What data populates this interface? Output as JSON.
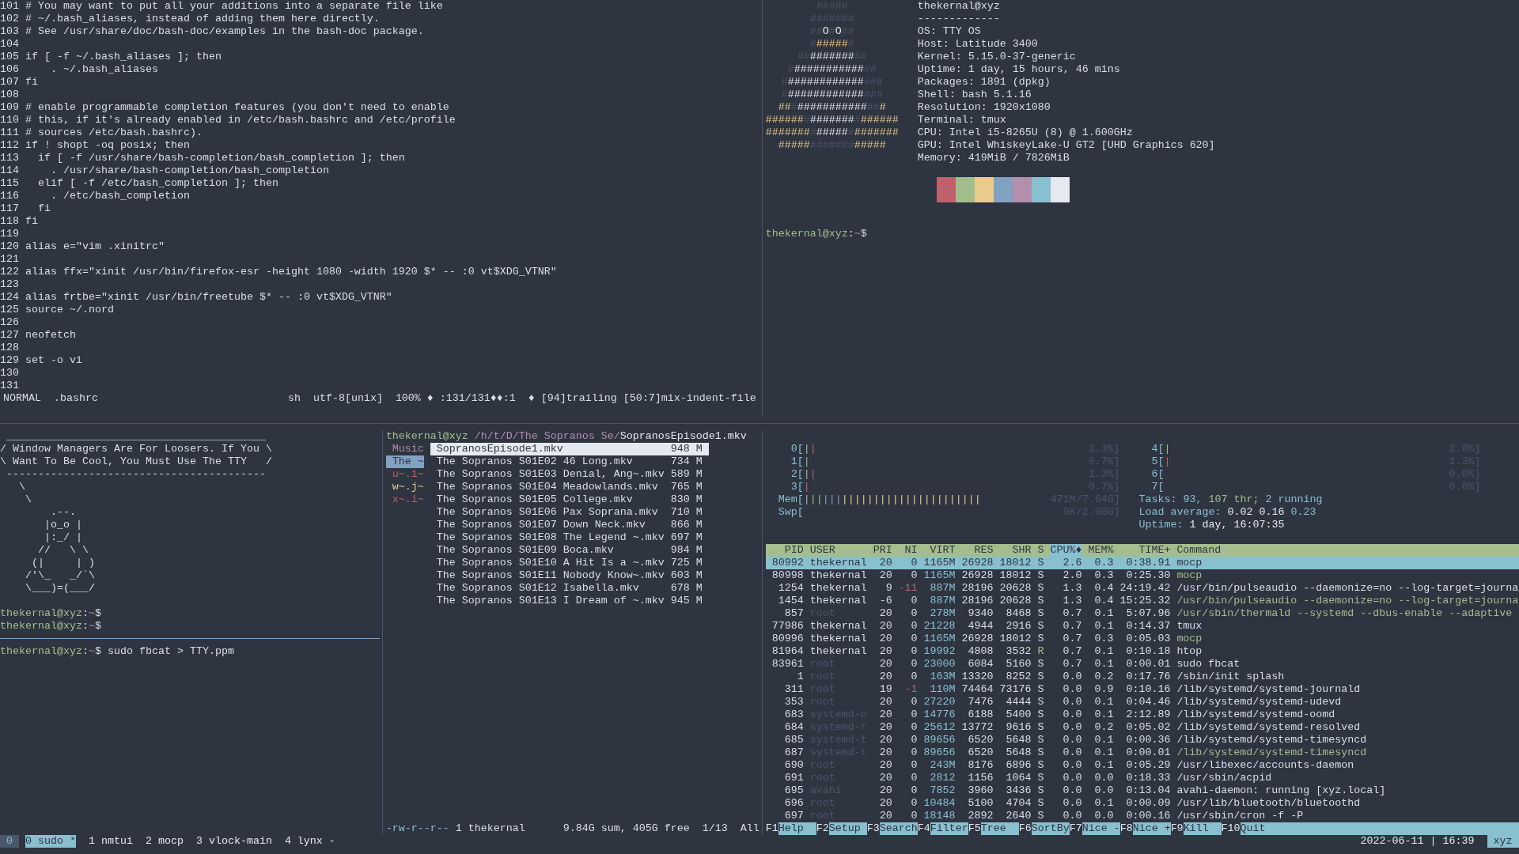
{
  "vim": {
    "lines": [
      {
        "number": "101",
        "text": "# You may want to put all your additions into a separate file like"
      },
      {
        "number": "102",
        "text": "# ~/.bash_aliases, instead of adding them here directly."
      },
      {
        "number": "103",
        "text": "# See /usr/share/doc/bash-doc/examples in the bash-doc package."
      },
      {
        "number": "104"
      },
      {
        "number": "105",
        "text": "if [ -f ~/.bash_aliases ]; then"
      },
      {
        "number": "106",
        "text": "    . ~/.bash_aliases"
      },
      {
        "number": "107",
        "text": "fi"
      },
      {
        "number": "108"
      },
      {
        "number": "109",
        "text": "# enable programmable completion features (you don't need to enable"
      },
      {
        "number": "110",
        "text": "# this, if it's already enabled in /etc/bash.bashrc and /etc/profile"
      },
      {
        "number": "111",
        "text": "# sources /etc/bash.bashrc)."
      },
      {
        "number": "112",
        "text": "if ! shopt -oq posix; then"
      },
      {
        "number": "113",
        "text": "  if [ -f /usr/share/bash-completion/bash_completion ]; then"
      },
      {
        "number": "114",
        "text": "    . /usr/share/bash-completion/bash_completion"
      },
      {
        "number": "115",
        "text": "  elif [ -f /etc/bash_completion ]; then"
      },
      {
        "number": "116",
        "text": "    . /etc/bash_completion"
      },
      {
        "number": "117",
        "text": "  fi"
      },
      {
        "number": "118",
        "text": "fi"
      },
      {
        "number": "119"
      },
      {
        "number": "120",
        "text": "alias e=\"vim .xinitrc\""
      },
      {
        "number": "121"
      },
      {
        "number": "122",
        "text": "alias ffx=\"xinit /usr/bin/firefox-esr -height 1080 -width 1920 $* -- :0 vt$XDG_VTNR\""
      },
      {
        "number": "123"
      },
      {
        "number": "124",
        "text": "alias frtbe=\"xinit /usr/bin/freetube $* -- :0 vt$XDG_VTNR\""
      },
      {
        "number": "125",
        "text": "source ~/.nord"
      },
      {
        "number": "126"
      },
      {
        "number": "127",
        "text": "neofetch"
      },
      {
        "number": "128"
      },
      {
        "number": "129",
        "text": "set -o vi"
      },
      {
        "number": "130"
      },
      {
        "number": "131"
      }
    ],
    "status": {
      "mode": "NORMAL",
      "file": ".bashrc",
      "filetype": "sh",
      "encoding": "utf-8[unix]",
      "position": "100% ♦ :131/131♦♦:1",
      "warnings": "♦ [94]trailing [50:7]mix-indent-file"
    }
  },
  "neofetch": {
    "logo": [
      [
        {
          "text": "#####",
          "kind": "dim"
        }
      ],
      [
        {
          "text": "#######",
          "kind": "dim"
        }
      ],
      [
        {
          "text": "##",
          "kind": "dim"
        },
        {
          "text": "O",
          "kind": "white"
        },
        {
          "text": "#",
          "kind": "dim"
        },
        {
          "text": "O",
          "kind": "white"
        },
        {
          "text": "##",
          "kind": "dim"
        }
      ],
      [
        {
          "text": "#",
          "kind": "dim"
        },
        {
          "text": "#####",
          "kind": "yellow"
        },
        {
          "text": "#",
          "kind": "dim"
        }
      ],
      [
        {
          "text": "##",
          "kind": "dim"
        },
        {
          "text": "#######",
          "kind": "white"
        },
        {
          "text": "##",
          "kind": "dim"
        }
      ],
      [
        {
          "text": "#",
          "kind": "dim"
        },
        {
          "text": "###########",
          "kind": "white"
        },
        {
          "text": "##",
          "kind": "dim"
        }
      ],
      [
        {
          "text": "#",
          "kind": "dim"
        },
        {
          "text": "############",
          "kind": "white"
        },
        {
          "text": "###",
          "kind": "dim"
        }
      ],
      [
        {
          "text": "#",
          "kind": "dim"
        },
        {
          "text": "############",
          "kind": "white"
        },
        {
          "text": "###",
          "kind": "dim"
        }
      ],
      [
        {
          "text": "##",
          "kind": "yellow"
        },
        {
          "text": "#",
          "kind": "dim"
        },
        {
          "text": "###########",
          "kind": "white"
        },
        {
          "text": "##",
          "kind": "dim"
        },
        {
          "text": "#",
          "kind": "yellow"
        }
      ],
      [
        {
          "text": "######",
          "kind": "yellow"
        },
        {
          "text": "#",
          "kind": "dim"
        },
        {
          "text": "#######",
          "kind": "white"
        },
        {
          "text": "#",
          "kind": "dim"
        },
        {
          "text": "######",
          "kind": "yellow"
        }
      ],
      [
        {
          "text": "#######",
          "kind": "yellow"
        },
        {
          "text": "#",
          "kind": "dim"
        },
        {
          "text": "#####",
          "kind": "white"
        },
        {
          "text": "#",
          "kind": "dim"
        },
        {
          "text": "#######",
          "kind": "yellow"
        }
      ],
      [
        {
          "text": "#####",
          "kind": "yellow"
        },
        {
          "text": "#######",
          "kind": "dim"
        },
        {
          "text": "#####",
          "kind": "yellow"
        }
      ]
    ],
    "info": [
      "thekernal@xyz",
      "-------------",
      "OS: TTY OS",
      "Host: Latitude 3400",
      "Kernel: 5.15.0-37-generic",
      "Uptime: 1 day, 15 hours, 46 mins",
      "Packages: 1891 (dpkg)",
      "Shell: bash 5.1.16",
      "Resolution: 1920x1080",
      "Terminal: tmux",
      "CPU: Intel i5-8265U (8) @ 1.600GHz",
      "GPU: Intel WhiskeyLake-U GT2 [UHD Graphics 620]",
      "Memory: 419MiB / 7826MiB"
    ],
    "swatches": [
      {
        "color": "#bf616a"
      },
      {
        "color": "#a3be8c"
      },
      {
        "color": "#ebcb8b"
      },
      {
        "color": "#81a1c1"
      },
      {
        "color": "#b48ead"
      },
      {
        "color": "#88c0d0"
      },
      {
        "color": "#e5e9f0"
      }
    ],
    "prompt": [
      {
        "text": "thekernal@xyz",
        "kind": "user"
      },
      {
        "text": ":",
        "kind": "plain"
      },
      {
        "text": "~",
        "kind": "path"
      },
      {
        "text": "$",
        "kind": "plain"
      }
    ]
  },
  "cowsay": [
    " _________________________________________",
    "/ Window Managers Are For Loosers. If You \\",
    "\\ Want To Be Cool, You Must Use The TTY   /",
    " -----------------------------------------",
    "   \\",
    "    \\",
    "        .--.",
    "       |o_o |",
    "       |:_/ |",
    "      //   \\ \\",
    "     (|     | )",
    "    /'\\_   _/`\\",
    "    \\___)=(___/"
  ],
  "shell_prompts": [
    [
      {
        "text": "thekernal@xyz",
        "kind": "user"
      },
      {
        "text": ":",
        "kind": "plain"
      },
      {
        "text": "~",
        "kind": "path"
      },
      {
        "text": "$",
        "kind": "plain"
      }
    ],
    [
      {
        "text": "thekernal@xyz",
        "kind": "user"
      },
      {
        "text": ":",
        "kind": "plain"
      },
      {
        "text": "~",
        "kind": "path"
      },
      {
        "text": "$",
        "kind": "plain"
      }
    ]
  ],
  "lower_shell": [
    {
      "text": "thekernal@xyz",
      "kind": "user"
    },
    {
      "text": ":",
      "kind": "plain"
    },
    {
      "text": "~",
      "kind": "path"
    },
    {
      "text": "$ sudo fbcat > TTY.ppm",
      "kind": "plain"
    }
  ],
  "ranger": {
    "path": [
      {
        "text": "thekernal@xyz",
        "kind": "user"
      },
      {
        "text": " /h/t/D/The Sopranos Se/",
        "kind": "path"
      },
      {
        "text": "SopranosEpisode1.mkv",
        "kind": "white"
      }
    ],
    "parent": [
      {
        "label": "Music",
        "selected": false,
        "color": "#b48ead"
      },
      {
        "label": "The ~",
        "selected": true,
        "color": "#81a1c1"
      },
      {
        "label": "u~.i~",
        "selected": false,
        "color": "#bf616a"
      },
      {
        "label": "w~.j~",
        "selected": false,
        "color": "#ebcb8b"
      },
      {
        "label": "x~.i~",
        "selected": false,
        "color": "#bf616a"
      }
    ],
    "files": [
      {
        "name": "SopranosEpisode1.mkv",
        "size": "948 M",
        "selected": true
      },
      {
        "name": "The Sopranos S01E02 46 Long.mkv",
        "size": "734 M",
        "selected": false
      },
      {
        "name": "The Sopranos S01E03 Denial, Ang~.mkv",
        "size": "589 M",
        "selected": false
      },
      {
        "name": "The Sopranos S01E04 Meadowlands.mkv",
        "size": "765 M",
        "selected": false
      },
      {
        "name": "The Sopranos S01E05 College.mkv",
        "size": "830 M",
        "selected": false
      },
      {
        "name": "The Sopranos S01E06 Pax Soprana.mkv",
        "size": "710 M",
        "selected": false
      },
      {
        "name": "The Sopranos S01E07 Down Neck.mkv",
        "size": "866 M",
        "selected": false
      },
      {
        "name": "The Sopranos S01E08 The Legend ~.mkv",
        "size": "697 M",
        "selected": false
      },
      {
        "name": "The Sopranos S01E09 Boca.mkv",
        "size": "984 M",
        "selected": false
      },
      {
        "name": "The Sopranos S01E10 A Hit Is a ~.mkv",
        "size": "725 M",
        "selected": false
      },
      {
        "name": "The Sopranos S01E11 Nobody Know~.mkv",
        "size": "603 M",
        "selected": false
      },
      {
        "name": "The Sopranos S01E12 Isabella.mkv",
        "size": "678 M",
        "selected": false
      },
      {
        "name": "The Sopranos S01E13 I Dream of ~.mkv",
        "size": "945 M",
        "selected": false
      }
    ],
    "footer": {
      "info": [
        {
          "text": "-rw-r--r--",
          "kind": "cyan"
        },
        {
          "text": " 1 thekernal",
          "kind": "plain"
        }
      ],
      "usage": "9.84G sum, 405G free",
      "position": "1/13",
      "scroll": "All"
    }
  },
  "htop": {
    "meters_left": [
      {
        "label": "0[",
        "bar": [
          {
            "text": "|",
            "kind": "green"
          },
          {
            "text": "|",
            "kind": "red"
          }
        ],
        "reading": "1.3%]"
      },
      {
        "label": "1[",
        "bar": [
          {
            "text": "|",
            "kind": "green"
          }
        ],
        "reading": "0.7%]"
      },
      {
        "label": "2[",
        "bar": [
          {
            "text": "|",
            "kind": "green"
          },
          {
            "text": "|",
            "kind": "red"
          }
        ],
        "reading": "1.3%]"
      },
      {
        "label": "3[",
        "bar": [
          {
            "text": "|",
            "kind": "red"
          }
        ],
        "reading": "0.7%]"
      },
      {
        "label": "Mem[",
        "bar": [
          {
            "text": "|||",
            "kind": "green"
          },
          {
            "text": "|||",
            "kind": "blue"
          },
          {
            "text": "||||||||||||||||||||||",
            "kind": "yellow"
          }
        ],
        "reading": "471M/7.64G]"
      },
      {
        "label": "Swp[",
        "reading": "0K/2.00G]"
      }
    ],
    "meters_right": [
      {
        "label": "4[",
        "bar": [
          {
            "text": "|",
            "kind": "green"
          }
        ],
        "reading": "2.0%]"
      },
      {
        "label": "5[",
        "bar": [
          {
            "text": "|",
            "kind": "red"
          }
        ],
        "reading": "1.3%]"
      },
      {
        "label": "6[",
        "reading": "0.0%]"
      },
      {
        "label": "7[",
        "reading": "0.0%]"
      }
    ],
    "summary": [
      [
        {
          "text": "Tasks: 93, ",
          "kind": "cyan"
        },
        {
          "text": "107 thr; ",
          "kind": "green"
        },
        {
          "text": "2 running",
          "kind": "cyan"
        }
      ],
      [
        {
          "text": "Load average: ",
          "kind": "cyan"
        },
        {
          "text": "0.02 0.16 ",
          "kind": "white"
        },
        {
          "text": "0.23",
          "kind": "cyan"
        }
      ],
      [
        {
          "text": "Uptime: ",
          "kind": "cyan"
        },
        {
          "text": "1 day, 16:07:35",
          "kind": "white"
        }
      ]
    ],
    "columns": [
      {
        "label": "PID",
        "sorted": false
      },
      {
        "label": "USER",
        "sorted": false
      },
      {
        "label": "PRI",
        "sorted": false
      },
      {
        "label": "NI",
        "sorted": false
      },
      {
        "label": "VIRT",
        "sorted": false
      },
      {
        "label": "RES",
        "sorted": false
      },
      {
        "label": "SHR",
        "sorted": false
      },
      {
        "label": "S",
        "sorted": false
      },
      {
        "label": "CPU%♦",
        "sorted": true
      },
      {
        "label": "MEM%",
        "sorted": false
      },
      {
        "label": "TIME+",
        "sorted": false
      },
      {
        "label": "Command",
        "sorted": false
      }
    ],
    "rows": [
      {
        "cells": [
          "80992",
          "thekernal",
          "20",
          "0",
          "1165M",
          "26928",
          "18012",
          "S",
          "2.6",
          "0.3",
          "0:38.91",
          "mocp"
        ],
        "selected": true,
        "dimmed": false,
        "elevated": false,
        "running": false,
        "thread": false
      },
      {
        "cells": [
          "80998",
          "thekernal",
          "20",
          "0",
          "1165M",
          "26928",
          "18012",
          "S",
          "2.0",
          "0.3",
          "0:25.30",
          "mocp"
        ],
        "selected": false,
        "dimmed": false,
        "elevated": false,
        "running": false,
        "thread": true
      },
      {
        "cells": [
          "1254",
          "thekernal",
          "9",
          "-11",
          "887M",
          "28196",
          "20628",
          "S",
          "1.3",
          "0.4",
          "24:19.42",
          "/usr/bin/pulseaudio --daemonize=no --log-target=journa"
        ],
        "selected": false,
        "dimmed": false,
        "elevated": true,
        "running": false,
        "thread": false
      },
      {
        "cells": [
          "1454",
          "thekernal",
          "-6",
          "0",
          "887M",
          "28196",
          "20628",
          "S",
          "1.3",
          "0.4",
          "15:25.32",
          "/usr/bin/pulseaudio --daemonize=no --log-target=journa"
        ],
        "selected": false,
        "dimmed": false,
        "elevated": false,
        "running": false,
        "thread": true
      },
      {
        "cells": [
          "857",
          "root",
          "20",
          "0",
          "278M",
          "9340",
          "8468",
          "S",
          "0.7",
          "0.1",
          "5:07.96",
          "/usr/sbin/thermald --systemd --dbus-enable --adaptive"
        ],
        "selected": false,
        "dimmed": true,
        "elevated": false,
        "running": false,
        "thread": true
      },
      {
        "cells": [
          "77986",
          "thekernal",
          "20",
          "0",
          "21228",
          "4944",
          "2916",
          "S",
          "0.7",
          "0.1",
          "0:14.37",
          "tmux"
        ],
        "selected": false,
        "dimmed": false,
        "elevated": false,
        "running": false,
        "thread": false
      },
      {
        "cells": [
          "80996",
          "thekernal",
          "20",
          "0",
          "1165M",
          "26928",
          "18012",
          "S",
          "0.7",
          "0.3",
          "0:05.03",
          "mocp"
        ],
        "selected": false,
        "dimmed": false,
        "elevated": false,
        "running": false,
        "thread": true
      },
      {
        "cells": [
          "81964",
          "thekernal",
          "20",
          "0",
          "19992",
          "4808",
          "3532",
          "R",
          "0.7",
          "0.1",
          "0:10.18",
          "htop"
        ],
        "selected": false,
        "dimmed": false,
        "elevated": false,
        "running": true,
        "thread": false
      },
      {
        "cells": [
          "83961",
          "root",
          "20",
          "0",
          "23000",
          "6084",
          "5160",
          "S",
          "0.7",
          "0.1",
          "0:00.01",
          "sudo fbcat"
        ],
        "selected": false,
        "dimmed": true,
        "elevated": false,
        "running": false,
        "thread": false
      },
      {
        "cells": [
          "1",
          "root",
          "20",
          "0",
          "163M",
          "13320",
          "8252",
          "S",
          "0.0",
          "0.2",
          "0:17.76",
          "/sbin/init splash"
        ],
        "selected": false,
        "dimmed": true,
        "elevated": false,
        "running": false,
        "thread": false
      },
      {
        "cells": [
          "311",
          "root",
          "19",
          "-1",
          "110M",
          "74464",
          "73176",
          "S",
          "0.0",
          "0.9",
          "0:10.16",
          "/lib/systemd/systemd-journald"
        ],
        "selected": false,
        "dimmed": true,
        "elevated": true,
        "running": false,
        "thread": false
      },
      {
        "cells": [
          "353",
          "root",
          "20",
          "0",
          "27220",
          "7476",
          "4444",
          "S",
          "0.0",
          "0.1",
          "0:04.46",
          "/lib/systemd/systemd-udevd"
        ],
        "selected": false,
        "dimmed": true,
        "elevated": false,
        "running": false,
        "thread": false
      },
      {
        "cells": [
          "683",
          "systemd-o",
          "20",
          "0",
          "14776",
          "6188",
          "5400",
          "S",
          "0.0",
          "0.1",
          "2:12.89",
          "/lib/systemd/systemd-oomd"
        ],
        "selected": false,
        "dimmed": true,
        "elevated": false,
        "running": false,
        "thread": false
      },
      {
        "cells": [
          "684",
          "systemd-r",
          "20",
          "0",
          "25612",
          "13772",
          "9616",
          "S",
          "0.0",
          "0.2",
          "0:05.02",
          "/lib/systemd/systemd-resolved"
        ],
        "selected": false,
        "dimmed": true,
        "elevated": false,
        "running": false,
        "thread": false
      },
      {
        "cells": [
          "685",
          "systemd-t",
          "20",
          "0",
          "89656",
          "6520",
          "5648",
          "S",
          "0.0",
          "0.1",
          "0:00.36",
          "/lib/systemd/systemd-timesyncd"
        ],
        "selected": false,
        "dimmed": true,
        "elevated": false,
        "running": false,
        "thread": false
      },
      {
        "cells": [
          "687",
          "systemd-t",
          "20",
          "0",
          "89656",
          "6520",
          "5648",
          "S",
          "0.0",
          "0.1",
          "0:00.01",
          "/lib/systemd/systemd-timesyncd"
        ],
        "selected": false,
        "dimmed": true,
        "elevated": false,
        "running": false,
        "thread": true
      },
      {
        "cells": [
          "690",
          "root",
          "20",
          "0",
          "243M",
          "8176",
          "6896",
          "S",
          "0.0",
          "0.1",
          "0:05.29",
          "/usr/libexec/accounts-daemon"
        ],
        "selected": false,
        "dimmed": true,
        "elevated": false,
        "running": false,
        "thread": false
      },
      {
        "cells": [
          "691",
          "root",
          "20",
          "0",
          "2812",
          "1156",
          "1064",
          "S",
          "0.0",
          "0.0",
          "0:18.33",
          "/usr/sbin/acpid"
        ],
        "selected": false,
        "dimmed": true,
        "elevated": false,
        "running": false,
        "thread": false
      },
      {
        "cells": [
          "695",
          "avahi",
          "20",
          "0",
          "7852",
          "3960",
          "3436",
          "S",
          "0.0",
          "0.0",
          "0:13.04",
          "avahi-daemon: running [xyz.local]"
        ],
        "selected": false,
        "dimmed": true,
        "elevated": false,
        "running": false,
        "thread": false
      },
      {
        "cells": [
          "696",
          "root",
          "20",
          "0",
          "10484",
          "5100",
          "4704",
          "S",
          "0.0",
          "0.1",
          "0:00.09",
          "/usr/lib/bluetooth/bluetoothd"
        ],
        "selected": false,
        "dimmed": true,
        "elevated": false,
        "running": false,
        "thread": false
      },
      {
        "cells": [
          "697",
          "root",
          "20",
          "0",
          "18148",
          "2892",
          "2640",
          "S",
          "0.0",
          "0.0",
          "0:00.16",
          "/usr/sbin/cron -f -P"
        ],
        "selected": false,
        "dimmed": true,
        "elevated": false,
        "running": false,
        "thread": false
      }
    ],
    "function_keys": [
      {
        "key": "F1",
        "label": "Help"
      },
      {
        "key": "F2",
        "label": "Setup"
      },
      {
        "key": "F3",
        "label": "Search"
      },
      {
        "key": "F4",
        "label": "Filter"
      },
      {
        "key": "F5",
        "label": "Tree"
      },
      {
        "key": "F6",
        "label": "SortBy"
      },
      {
        "key": "F7",
        "label": "Nice -"
      },
      {
        "key": "F8",
        "label": "Nice +"
      },
      {
        "key": "F9",
        "label": "Kill"
      },
      {
        "key": "F10",
        "label": "Quit"
      }
    ]
  },
  "tmux": {
    "session": "0",
    "windows": [
      {
        "label": "0 sudo *",
        "selected": true
      },
      {
        "label": "1 nmtui",
        "selected": false
      },
      {
        "label": "2 mocp",
        "selected": false
      },
      {
        "label": "3 vlock-main",
        "selected": false
      },
      {
        "label": "4 lynx -",
        "selected": false
      }
    ],
    "clock": "2022-06-11 | 16:39",
    "host": "xyz"
  }
}
